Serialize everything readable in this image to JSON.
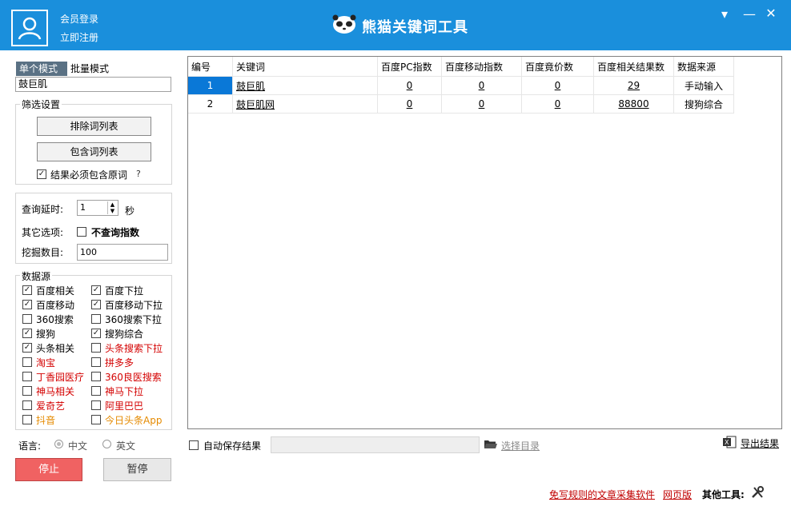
{
  "header": {
    "login": "会员登录",
    "register": "立即注册",
    "title": "熊猫关键词工具",
    "controls": [
      "▾",
      "—",
      "✕"
    ]
  },
  "modes": {
    "single": "单个模式",
    "batch": "批量模式"
  },
  "keyword_input": "鼓巨肌",
  "filter": {
    "title": "筛选设置",
    "exclude_btn": "排除词列表",
    "include_btn": "包含词列表",
    "must_include": "结果必须包含原词",
    "help": "?"
  },
  "options": {
    "delay_label": "查询延时:",
    "delay_value": "1",
    "delay_unit": "秒",
    "other_label": "其它选项:",
    "no_index": "不查询指数",
    "depth_label": "挖掘数目:",
    "depth_value": "100"
  },
  "sources": {
    "title": "数据源",
    "items": [
      {
        "label": "百度相关",
        "checked": true,
        "color": "black"
      },
      {
        "label": "百度下拉",
        "checked": true,
        "color": "black"
      },
      {
        "label": "百度移动",
        "checked": true,
        "color": "black"
      },
      {
        "label": "百度移动下拉",
        "checked": true,
        "color": "black"
      },
      {
        "label": "360搜索",
        "checked": false,
        "color": "black"
      },
      {
        "label": "360搜索下拉",
        "checked": false,
        "color": "black"
      },
      {
        "label": "搜狗",
        "checked": true,
        "color": "black"
      },
      {
        "label": "搜狗综合",
        "checked": true,
        "color": "black"
      },
      {
        "label": "头条相关",
        "checked": true,
        "color": "black"
      },
      {
        "label": "头条搜索下拉",
        "checked": false,
        "color": "red"
      },
      {
        "label": "淘宝",
        "checked": false,
        "color": "red"
      },
      {
        "label": "拼多多",
        "checked": false,
        "color": "red"
      },
      {
        "label": "丁香园医疗",
        "checked": false,
        "color": "red"
      },
      {
        "label": "360良医搜索",
        "checked": false,
        "color": "red"
      },
      {
        "label": "神马相关",
        "checked": false,
        "color": "red"
      },
      {
        "label": "神马下拉",
        "checked": false,
        "color": "red"
      },
      {
        "label": "爱奇艺",
        "checked": false,
        "color": "red"
      },
      {
        "label": "阿里巴巴",
        "checked": false,
        "color": "red"
      },
      {
        "label": "抖音",
        "checked": false,
        "color": "orange"
      },
      {
        "label": "今日头条App",
        "checked": false,
        "color": "orange"
      }
    ]
  },
  "language": {
    "label": "语言:",
    "zh": "中文",
    "en": "英文"
  },
  "buttons": {
    "stop": "停止",
    "pause": "暂停"
  },
  "table": {
    "headers": [
      "编号",
      "关键词",
      "百度PC指数",
      "百度移动指数",
      "百度竟价数",
      "百度相关结果数",
      "数据来源"
    ],
    "rows": [
      [
        "1",
        "鼓巨肌",
        "0",
        "0",
        "0",
        "29",
        "手动输入"
      ],
      [
        "2",
        "鼓巨肌网",
        "0",
        "0",
        "0",
        "88800",
        "搜狗综合"
      ]
    ]
  },
  "footer": {
    "autosave": "自动保存结果",
    "choose_dir": "选择目录",
    "export": "导出结果",
    "promo": "免写规则的文章采集软件",
    "web": "网页版",
    "other_tools": "其他工具:"
  },
  "colors": {
    "accent": "#1a8fdc",
    "stop": "#f06262",
    "red_text": "#d40000",
    "orange_text": "#e58a00"
  }
}
